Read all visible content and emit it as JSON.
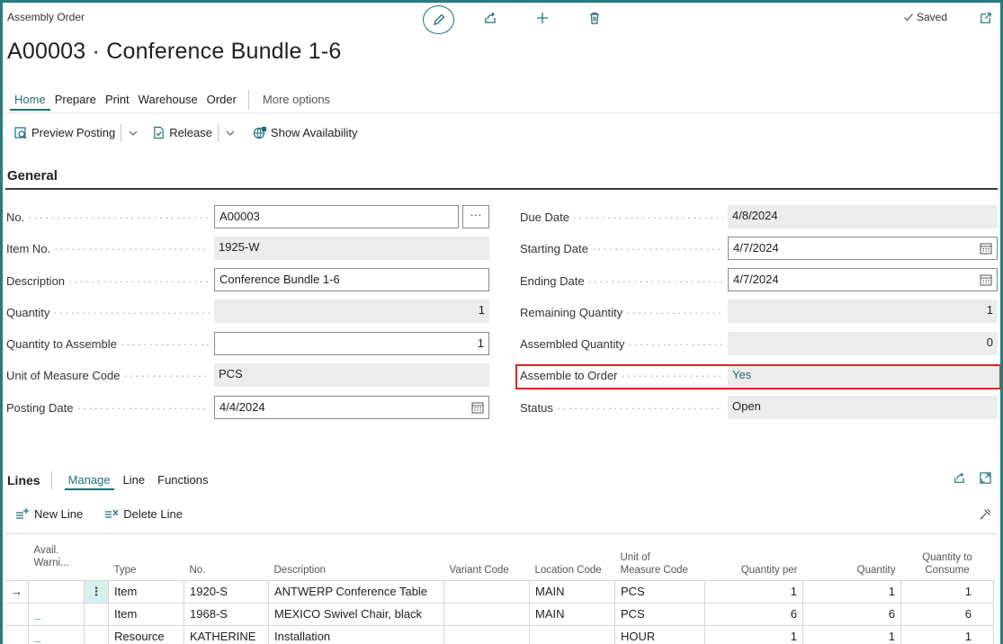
{
  "page": {
    "type_label": "Assembly Order",
    "title": "A00003 · Conference Bundle 1-6",
    "saved_label": "Saved"
  },
  "action_tabs": [
    {
      "label": "Home",
      "active": true
    },
    {
      "label": "Prepare"
    },
    {
      "label": "Print"
    },
    {
      "label": "Warehouse"
    },
    {
      "label": "Order"
    }
  ],
  "more_options": "More options",
  "promoted": {
    "preview_posting": "Preview Posting",
    "release": "Release",
    "show_availability": "Show Availability"
  },
  "general": {
    "title": "General",
    "left": [
      {
        "label": "No.",
        "value": "A00003"
      },
      {
        "label": "Item No.",
        "value": "1925-W"
      },
      {
        "label": "Description",
        "value": "Conference Bundle 1-6"
      },
      {
        "label": "Quantity",
        "value": "1"
      },
      {
        "label": "Quantity to Assemble",
        "value": "1"
      },
      {
        "label": "Unit of Measure Code",
        "value": "PCS"
      },
      {
        "label": "Posting Date",
        "value": "4/4/2024"
      }
    ],
    "right": [
      {
        "label": "Due Date",
        "value": "4/8/2024"
      },
      {
        "label": "Starting Date",
        "value": "4/7/2024"
      },
      {
        "label": "Ending Date",
        "value": "4/7/2024"
      },
      {
        "label": "Remaining Quantity",
        "value": "1"
      },
      {
        "label": "Assembled Quantity",
        "value": "0"
      },
      {
        "label": "Assemble to Order",
        "value": "Yes"
      },
      {
        "label": "Status",
        "value": "Open"
      }
    ],
    "ellipsis": "···"
  },
  "lines": {
    "title": "Lines",
    "tabs": [
      {
        "label": "Manage",
        "active": true
      },
      {
        "label": "Line"
      },
      {
        "label": "Functions"
      }
    ],
    "new_line": "New Line",
    "delete_line": "Delete Line",
    "columns": {
      "avail": "Avail. Warni...",
      "type": "Type",
      "no": "No.",
      "description": "Description",
      "variant": "Variant Code",
      "location": "Location Code",
      "uom_1": "Unit of",
      "uom_2": "Measure Code",
      "qty_per": "Quantity per",
      "quantity": "Quantity",
      "qty_consume_1": "Quantity to",
      "qty_consume_2": "Consume"
    },
    "rows": [
      {
        "marker": "→",
        "warn": "",
        "type": "Item",
        "no": "1920-S",
        "description": "ANTWERP Conference Table",
        "variant": "",
        "location": "MAIN",
        "uom": "PCS",
        "qty_per": "1",
        "quantity": "1",
        "qty_consume": "1"
      },
      {
        "marker": "",
        "warn": "_",
        "type": "Item",
        "no": "1968-S",
        "description": "MEXICO Swivel Chair, black",
        "variant": "",
        "location": "MAIN",
        "uom": "PCS",
        "qty_per": "6",
        "quantity": "6",
        "qty_consume": "6"
      },
      {
        "marker": "",
        "warn": "_",
        "type": "Resource",
        "no": "KATHERINE",
        "description": "Installation",
        "variant": "",
        "location": "",
        "uom": "HOUR",
        "qty_per": "1",
        "quantity": "1",
        "qty_consume": "1"
      }
    ]
  },
  "colors": {
    "accent": "#1f6f73",
    "frame": "#2b7a7e",
    "highlight": "#e02424"
  }
}
